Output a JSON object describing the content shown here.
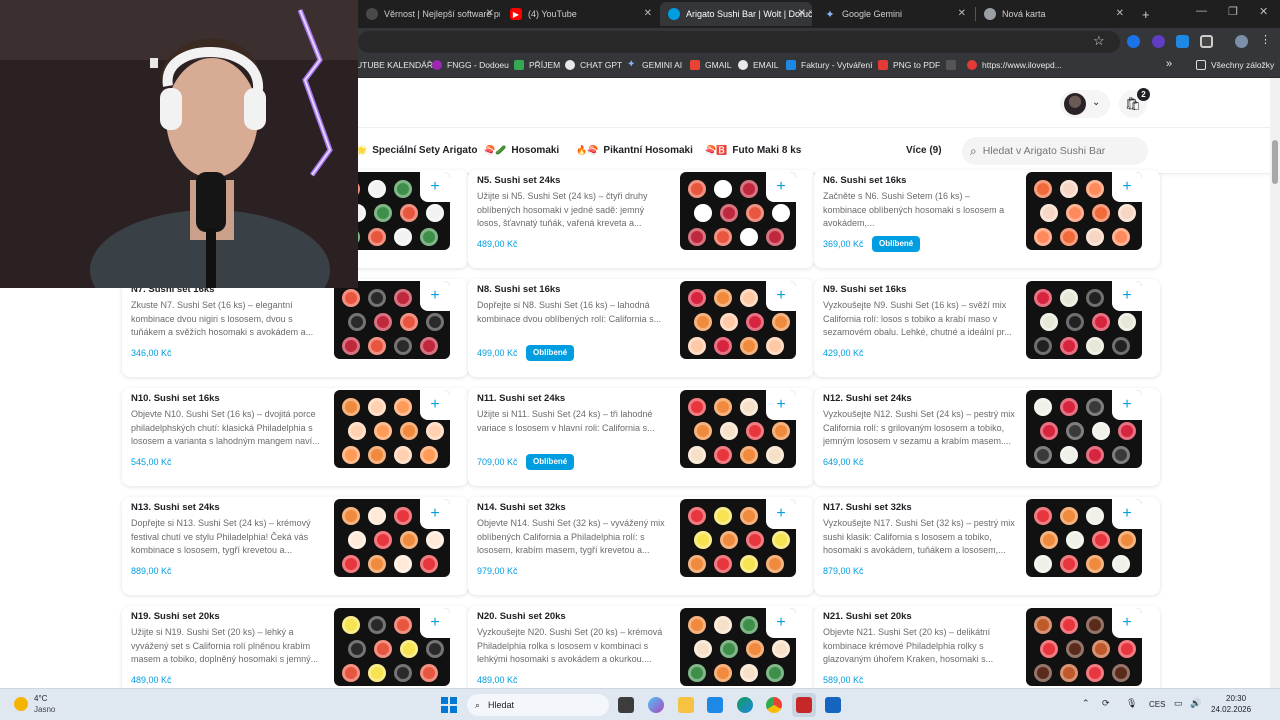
{
  "browser": {
    "tabs": [
      {
        "title": "Věrnost | Nejlepší software pro"
      },
      {
        "title": "(4) YouTube"
      },
      {
        "title": "Arigato Sushi Bar | Wolt | Doruč"
      },
      {
        "title": "Google Gemini"
      },
      {
        "title": "Nová karta"
      }
    ],
    "new_tab": "+",
    "bookmarks": [
      "UTUBE KALENDÁŘ",
      "FNGG - Dodoeu",
      "PŘÍJEM",
      "CHAT GPT",
      "GEMINI AI",
      "GMAIL",
      "EMAIL",
      "Faktury - Vytváření",
      "PNG to PDF",
      "https://www.ilovepd..."
    ],
    "bookmarks_more": "»",
    "all_bookmarks": "Všechny záložky"
  },
  "header": {
    "cart_count": "2"
  },
  "categories": [
    {
      "emoji": "🌟",
      "label": "Speciální Sety Arigato"
    },
    {
      "emoji": "🍣🥒",
      "label": "Hosomaki"
    },
    {
      "emoji": "🔥🍣",
      "label": "Pikantní Hosomaki"
    },
    {
      "emoji": "🍣🅱️",
      "label": "Futo Maki 8 ks"
    }
  ],
  "more_label": "Více (9)",
  "search": {
    "placeholder": "Hledat v Arigato Sushi Bar"
  },
  "products": [
    {
      "title": "",
      "desc": "",
      "price": "",
      "badge": ""
    },
    {
      "title": "N5. Sushi set 24ks",
      "desc": "Užijte si N5. Sushi Set (24 ks) – čtyři druhy oblíbených hosomaki v jedné sadě: jemný losos, šťavnatý tuňák, vařená kreveta a...",
      "price": "489,00 Kč",
      "badge": ""
    },
    {
      "title": "N6. Sushi set 16ks",
      "desc": "Začněte s N6. Sushi Setem (16 ks) – kombinace oblíbených hosomaki s lososem a avokádem,...",
      "price": "369,00 Kč",
      "badge": "Oblíbené"
    },
    {
      "title": "N7. Sushi set 16ks",
      "desc": "Zkuste N7. Sushi Set (16 ks) – elegantní kombinace dvou nigiri s lososem, dvou s tuňákem a svěžích hosomaki s avokádem a...",
      "price": "346,00 Kč",
      "badge": ""
    },
    {
      "title": "N8. Sushi set 16ks",
      "desc": "Dopřejte si N8. Sushi Set (16 ks) – lahodná kombinace dvou oblíbených rolí: California s...",
      "price": "499,00 Kč",
      "badge": "Oblíbené"
    },
    {
      "title": "N9. Sushi set 16ks",
      "desc": "Vyzkoušejte N9. Sushi Set (16 ks) – svěží mix California rolí: losos s tobiko a krabí maso v sezamovém obalu. Lehké, chutné a ideální pr...",
      "price": "429,00 Kč",
      "badge": ""
    },
    {
      "title": "N10. Sushi set 16ks",
      "desc": "Objevte N10. Sushi Set (16 ks) – dvojitá porce philadelphských chutí: klasická Philadelphia s lososem a varianta s lahodným mangem naví...",
      "price": "545,00 Kč",
      "badge": ""
    },
    {
      "title": "N11. Sushi set 24ks",
      "desc": "Užijte si N11. Sushi Set (24 ks) – tři lahodné variace s lososem v hlavní roli: California s...",
      "price": "709,00 Kč",
      "badge": "Oblíbené"
    },
    {
      "title": "N12. Sushi set 24ks",
      "desc": "Vyzkoušejte N12. Sushi Set (24 ks) – pestrý mix California rolí: s grilovaným lososem a tobiko, jemným lososem v sezamu a krabím masem....",
      "price": "649,00 Kč",
      "badge": ""
    },
    {
      "title": "N13. Sushi set 24ks",
      "desc": "Dopřejte si N13. Sushi Set (24 ks) – krémový festival chutí ve stylu Philadelphia! Čeká vás kombinace s lososem, tygří krevetou a...",
      "price": "889,00 Kč",
      "badge": ""
    },
    {
      "title": "N14. Sushi set 32ks",
      "desc": "Objevte N14. Sushi Set (32 ks) – vyvážený mix oblíbených California a Philadelphia rolí: s lososem, krabím masem, tygří krevetou a...",
      "price": "979,00 Kč",
      "badge": ""
    },
    {
      "title": "N17. Sushi set 32ks",
      "desc": "Vyzkoušejte N17. Sushi Set (32 ks) – pestrý mix sushi klasik: California s lososem a tobiko, hosomaki s avokádem, tuňákem a lososem,...",
      "price": "879,00 Kč",
      "badge": ""
    },
    {
      "title": "N19. Sushi set 20ks",
      "desc": "Užijte si N19. Sushi Set (20 ks) – lehký a vyvážený set s California rolí plněnou krabím masem a tobiko, doplněný hosomaki s jemný...",
      "price": "489,00 Kč",
      "badge": ""
    },
    {
      "title": "N20. Sushi set 20ks",
      "desc": "Vyzkoušejte N20. Sushi Set (20 ks) – krémová Philadelphia rolka s lososem v kombinaci s lehkými hosomaki s avokádem a okurkou....",
      "price": "489,00 Kč",
      "badge": ""
    },
    {
      "title": "N21. Sushi set 20ks",
      "desc": "Objevte N21. Sushi Set (20 ks) – delikátní kombinace krémové Philadelphia rolky s glazovaným úhořem Kraken, hosomaki s...",
      "price": "589,00 Kč",
      "badge": ""
    }
  ],
  "add_label": "+",
  "taskbar": {
    "temp": "4°C",
    "condition": "Jasno",
    "search": "Hledat",
    "lang": "CES",
    "time": "20:30",
    "date": "24.02.2026"
  },
  "colors": {
    "accent": "#009de0",
    "text": "#202125",
    "muted": "#6b6b6b"
  }
}
